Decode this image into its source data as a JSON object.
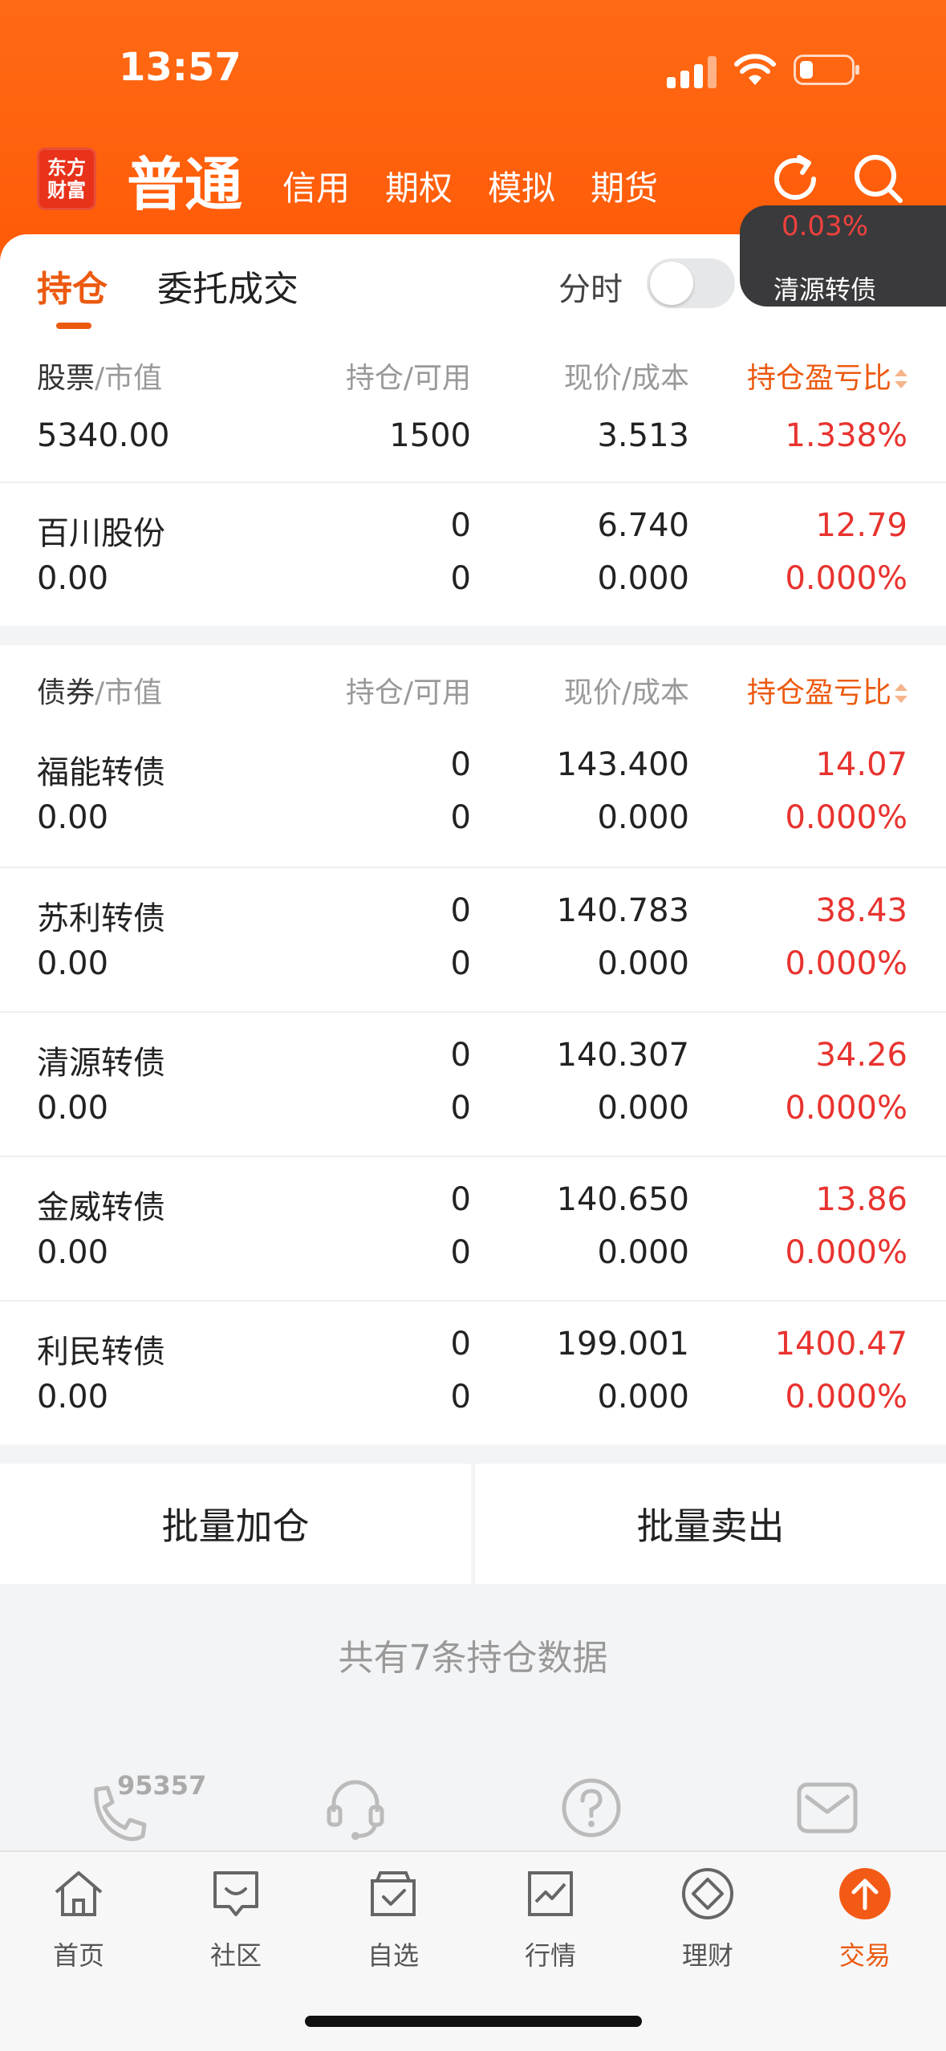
{
  "status_bar": {
    "time": "13:57"
  },
  "header": {
    "logo_line1": "东方",
    "logo_line2": "财富",
    "account_tabs": [
      {
        "label": "普通",
        "active": true
      },
      {
        "label": "信用"
      },
      {
        "label": "期权"
      },
      {
        "label": "模拟"
      },
      {
        "label": "期货"
      }
    ],
    "refresh_icon": "refresh-icon",
    "search_icon": "search-icon"
  },
  "floating_quote": {
    "percent": "0.03%",
    "name": "清源转债"
  },
  "sub_tabs": {
    "tabs": [
      {
        "label": "持仓",
        "active": true
      },
      {
        "label": "委托成交"
      }
    ],
    "fenshi_label": "分时",
    "fenshi_on": false
  },
  "stock_section": {
    "header": {
      "col1_lead": "股票",
      "col1_rest": "/市值",
      "col2": "持仓/可用",
      "col3": "现价/成本",
      "col4": "持仓盈亏比"
    },
    "summary": {
      "market_value": "5340.00",
      "position": "1500",
      "price": "3.513",
      "pl_ratio": "1.338%"
    },
    "rows": [
      {
        "name": "百川股份",
        "value": "0.00",
        "position": "0",
        "available": "0",
        "price": "6.740",
        "cost": "0.000",
        "pl": "12.79",
        "pl_ratio": "0.000%"
      }
    ]
  },
  "bond_section": {
    "header": {
      "col1_lead": "债券",
      "col1_rest": "/市值",
      "col2": "持仓/可用",
      "col3": "现价/成本",
      "col4": "持仓盈亏比"
    },
    "rows": [
      {
        "name": "福能转债",
        "value": "0.00",
        "position": "0",
        "available": "0",
        "price": "143.400",
        "cost": "0.000",
        "pl": "14.07",
        "pl_ratio": "0.000%"
      },
      {
        "name": "苏利转债",
        "value": "0.00",
        "position": "0",
        "available": "0",
        "price": "140.783",
        "cost": "0.000",
        "pl": "38.43",
        "pl_ratio": "0.000%"
      },
      {
        "name": "清源转债",
        "value": "0.00",
        "position": "0",
        "available": "0",
        "price": "140.307",
        "cost": "0.000",
        "pl": "34.26",
        "pl_ratio": "0.000%"
      },
      {
        "name": "金威转债",
        "value": "0.00",
        "position": "0",
        "available": "0",
        "price": "140.650",
        "cost": "0.000",
        "pl": "13.86",
        "pl_ratio": "0.000%"
      },
      {
        "name": "利民转债",
        "value": "0.00",
        "position": "0",
        "available": "0",
        "price": "199.001",
        "cost": "0.000",
        "pl": "1400.47",
        "pl_ratio": "0.000%"
      }
    ]
  },
  "actions": {
    "batch_add": "批量加仓",
    "batch_sell": "批量卖出"
  },
  "summary_text": "共有7条持仓数据",
  "services": {
    "hotline_number": "95357"
  },
  "bottom_nav": [
    {
      "label": "首页",
      "icon": "home-icon"
    },
    {
      "label": "社区",
      "icon": "community-icon"
    },
    {
      "label": "自选",
      "icon": "watchlist-icon"
    },
    {
      "label": "行情",
      "icon": "market-icon"
    },
    {
      "label": "理财",
      "icon": "wealth-icon"
    },
    {
      "label": "交易",
      "icon": "trade-icon",
      "active": true
    }
  ],
  "colors": {
    "brand_orange": "#ff5a08",
    "accent": "#ec5a10",
    "loss_red": "#e8332f"
  }
}
